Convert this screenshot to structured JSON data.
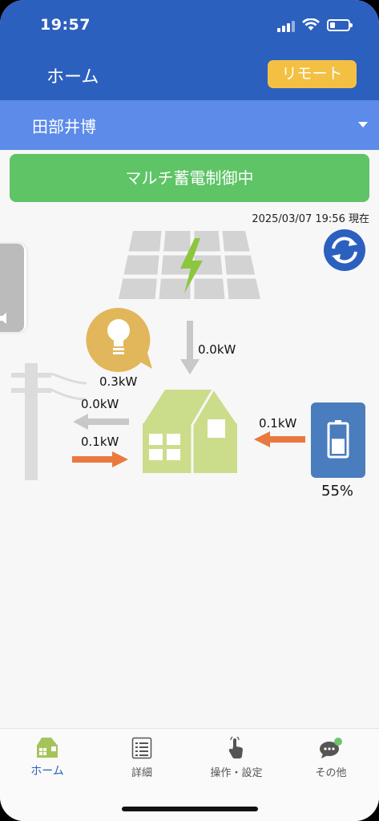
{
  "status_bar": {
    "time": "19:57"
  },
  "header": {
    "title": "ホーム",
    "remote_label": "リモート"
  },
  "site_selector": {
    "selected": "田部井博"
  },
  "mode_banner": "マルチ蓄電制御中",
  "timestamp": "2025/03/07 19:56 現在",
  "energy_flow": {
    "solar_power": "0.0kW",
    "consumption": "0.3kW",
    "grid_sell": "0.0kW",
    "grid_buy": "0.1kW",
    "battery_discharge": "0.1kW",
    "battery_level": "55%",
    "battery_fill_fraction": 0.55
  },
  "tabbar": {
    "tabs": [
      {
        "label": "ホーム",
        "icon": "house-icon"
      },
      {
        "label": "詳細",
        "icon": "list-icon"
      },
      {
        "label": "操作・設定",
        "icon": "hand-pointer-icon"
      },
      {
        "label": "その他",
        "icon": "chat-bubble-icon"
      }
    ]
  },
  "colors": {
    "header_blue": "#2c60bf",
    "selector_blue": "#5c8be9",
    "remote_yellow": "#f3c044",
    "banner_green": "#5ec466",
    "house_green": "#cbdd8a",
    "bulb_gold": "#e2b65a",
    "battery_blue": "#4a7dbd",
    "flow_orange": "#e9793f",
    "flow_grey": "#c8c8c8"
  }
}
